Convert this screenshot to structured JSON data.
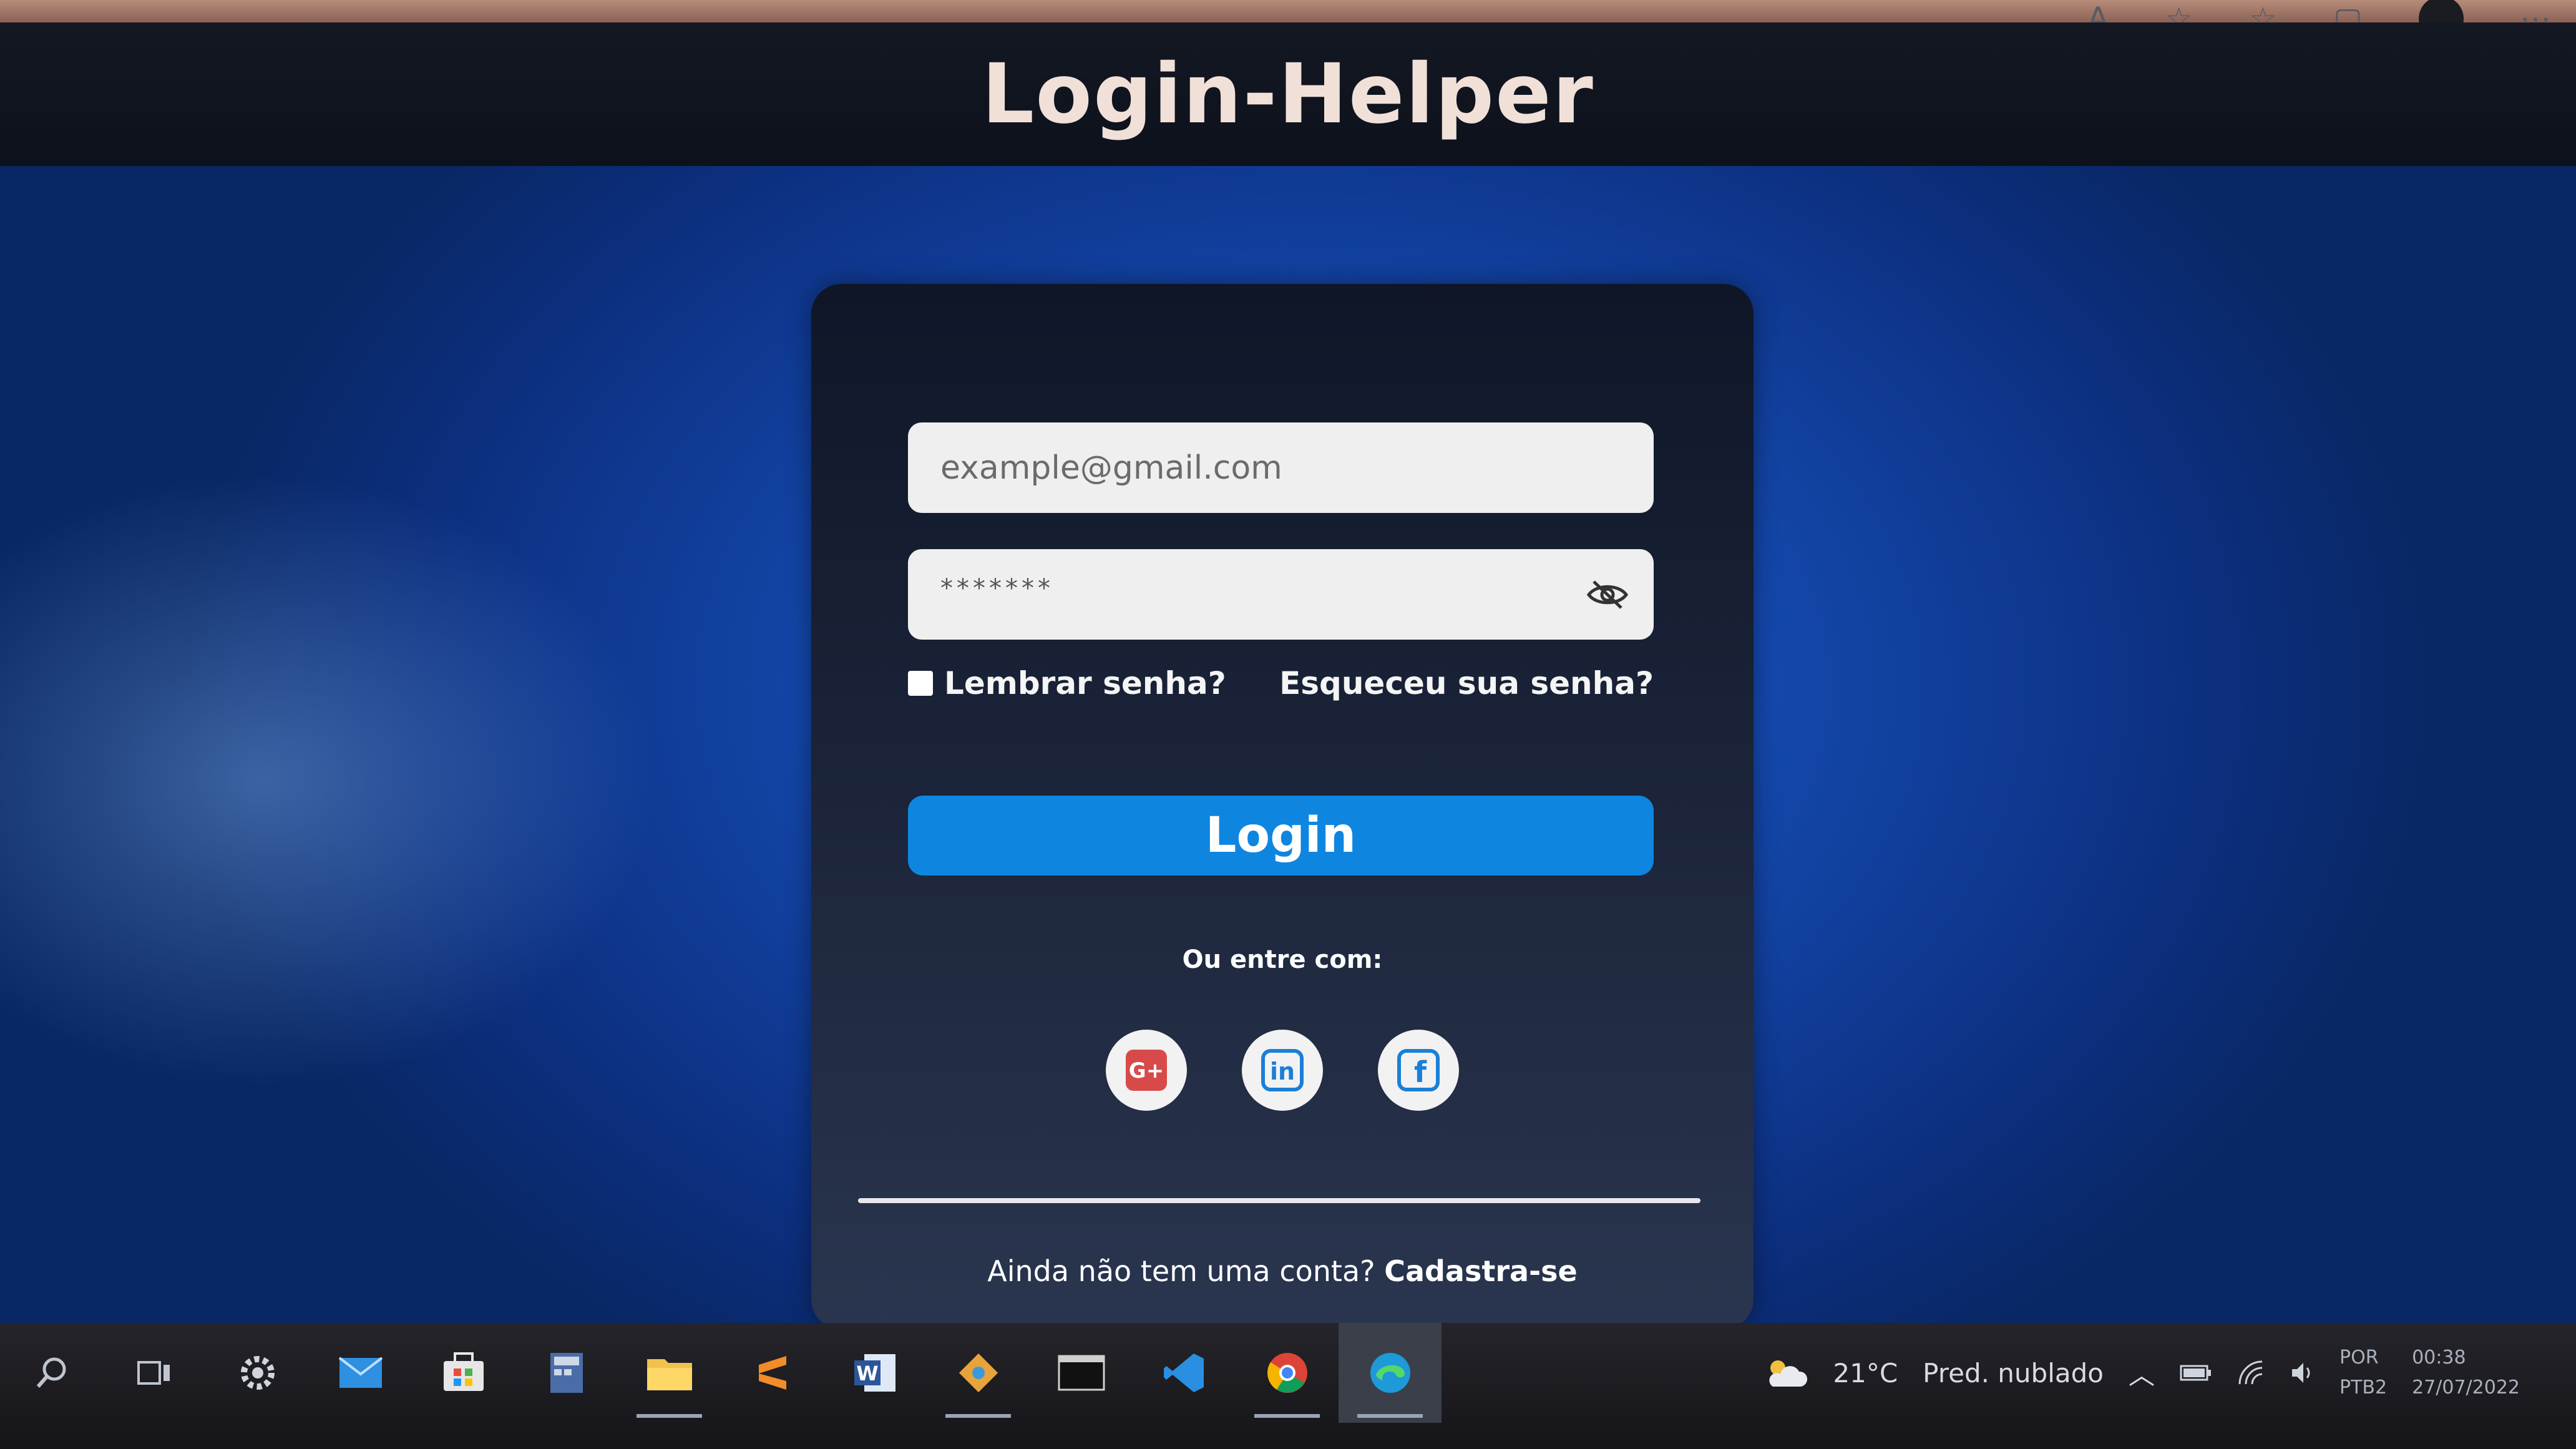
{
  "header": {
    "title": "Login-Helper"
  },
  "form": {
    "email_placeholder": "example@gmail.com",
    "password_masked": "*******",
    "remember_label": "Lembrar senha?",
    "remember_checked": false,
    "forgot_label": "Esqueceu sua senha?",
    "login_label": "Login",
    "alt_login_label": "Ou entre com:",
    "social": [
      {
        "icon": "google-plus-icon",
        "label": "G+",
        "color": "#d84a4a"
      },
      {
        "icon": "linkedin-icon",
        "label": "in",
        "color": "#1a7fd6"
      },
      {
        "icon": "facebook-icon",
        "label": "f",
        "color": "#1a7fd6"
      }
    ],
    "signup_prompt": "Ainda não tem uma conta?",
    "signup_link": "Cadastra-se"
  },
  "taskbar": {
    "apps": [
      "search-icon",
      "task-view-icon",
      "settings-icon",
      "mail-icon",
      "store-icon",
      "calculator-icon",
      "file-explorer-icon",
      "sublime-text-icon",
      "word-icon",
      "git-icon",
      "terminal-icon",
      "vscode-icon",
      "chrome-icon",
      "edge-icon"
    ],
    "weather_temp": "21°C",
    "weather_text": "Pred. nublado",
    "lang_top": "POR",
    "lang_bottom": "PTB2",
    "time": "00:38",
    "date": "27/07/2022"
  },
  "colors": {
    "login_button": "#0e86e0",
    "header_bg": "#141823",
    "card_bg": "#1a2338",
    "desktop_blue": "#1448ad"
  }
}
